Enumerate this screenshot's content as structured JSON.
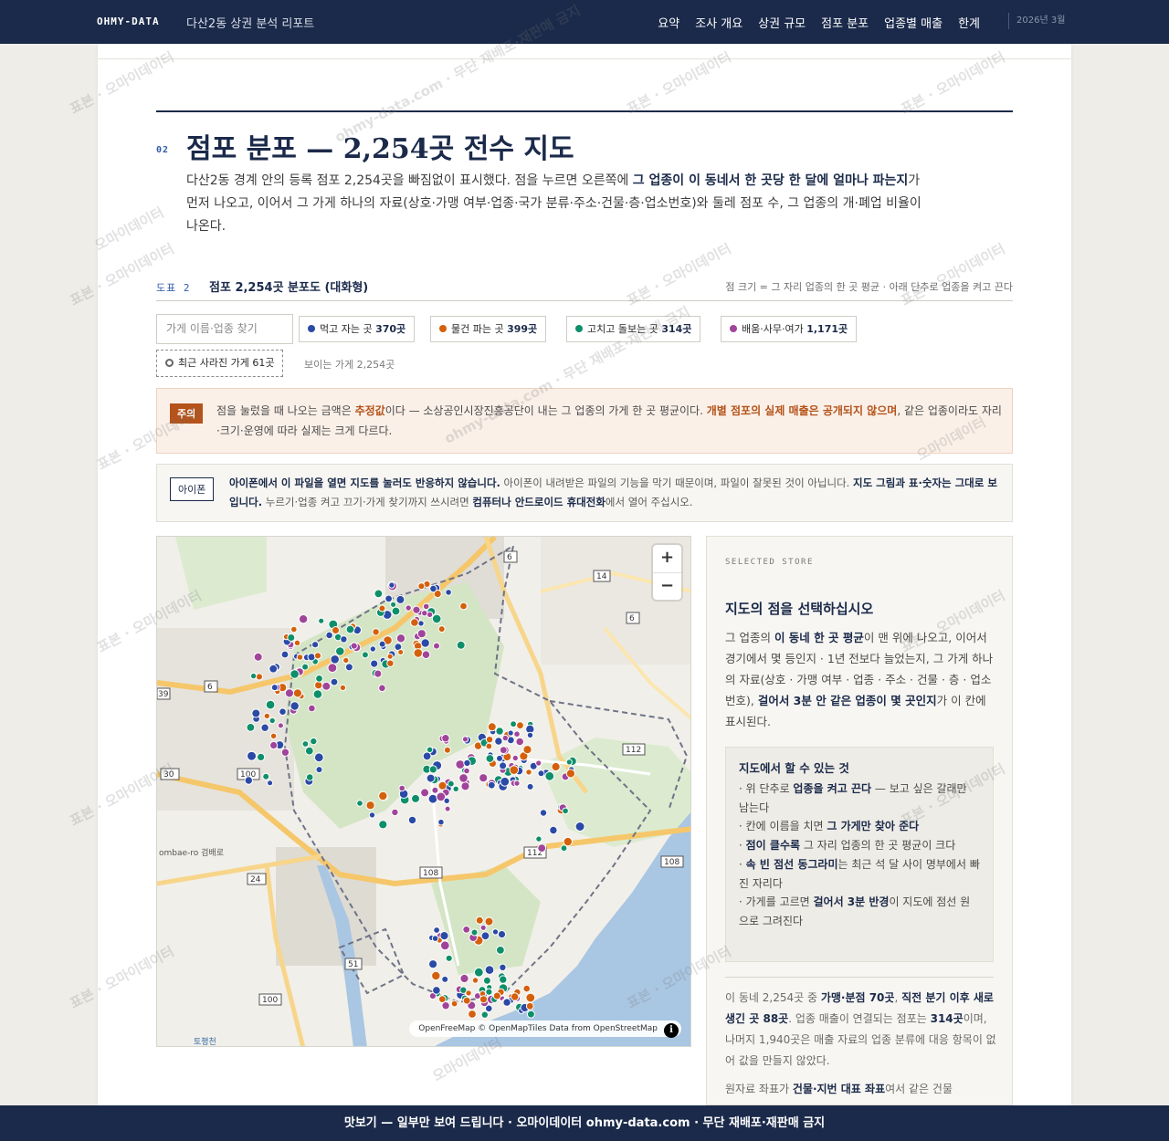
{
  "nav": {
    "brand": "OHMY-DATA",
    "report_title": "다산2동 상권 분석 리포트",
    "links": [
      "요약",
      "조사 개요",
      "상권 규모",
      "점포 분포",
      "업종별 매출",
      "한계"
    ],
    "date": "2026년 3월"
  },
  "section": {
    "number": "02",
    "title": "점포 분포 — 2,254곳 전수 지도",
    "desc_1": "다산2동 경계 안의 등록 점포 2,254곳을 빠짐없이 표시했다. 점을 누르면 오른쪽에 ",
    "desc_bold": "그 업종이 이 동네서 한 곳당 한 달에 얼마나 파는지",
    "desc_2": "가 먼저 나오고, 이어서 그 가게 하나의 자료(상호·가맹 여부·업종·국가 분류·주소·건물·층·업소번호)와 둘레 점포 수, 그 업종의 개·폐업 비율이 나온다."
  },
  "figure": {
    "number": "도표 2",
    "title": "점포 2,254곳 분포도 (대화형)",
    "note": "점 크기 = 그 자리 업종의 한 곳 평균 · 아래 단추로 업종을 켜고 끈다"
  },
  "filters": {
    "search_placeholder": "가게 이름·업종 찾기",
    "chips": [
      {
        "label": "먹고 자는 곳",
        "count": "370곳",
        "color": "#2b4aa6"
      },
      {
        "label": "물건 파는 곳",
        "count": "399곳",
        "color": "#d4600c"
      },
      {
        "label": "고치고 돌보는 곳",
        "count": "314곳",
        "color": "#0e8f6a"
      },
      {
        "label": "배움·사무·여가",
        "count": "1,171곳",
        "color": "#a0449a"
      }
    ],
    "closed_label": "최근 사라진 가게 61곳",
    "visible_count": "보이는 가게 2,254곳"
  },
  "warning": {
    "badge": "주의",
    "t1": "점을 눌렀을 때 나오는 금액은 ",
    "b1": "추정값",
    "t2": "이다 — 소상공인시장진흥공단이 내는 그 업종의 가게 한 곳 평균이다. ",
    "b2": "개별 점포의 실제 매출은 공개되지 않으며",
    "t3": ", 같은 업종이라도 자리·크기·운영에 따라 실제는 크게 다르다."
  },
  "ios": {
    "badge": "아이폰",
    "b1": "아이폰에서 이 파일을 열면 지도를 눌러도 반응하지 않습니다.",
    "t1": " 아이폰이 내려받은 파일의 기능을 막기 때문이며, 파일이 잘못된 것이 아닙니다. ",
    "b2": "지도 그림과 표·숫자는 그대로 보입니다.",
    "t2": " 누르기·업종 켜고 끄기·가게 찾기까지 쓰시려면 ",
    "b3": "컴퓨터나 안드로이드 휴대전화",
    "t3": "에서 열어 주십시오."
  },
  "map": {
    "zoom_in": "+",
    "zoom_out": "−",
    "attribution": "OpenFreeMap © OpenMapTiles Data from OpenStreetMap",
    "info": "i",
    "road_labels": [
      "6",
      "14",
      "6",
      "6",
      "39",
      "112",
      "30",
      "100",
      "24",
      "108",
      "112",
      "108",
      "51",
      "100"
    ],
    "place_labels": [
      "ombae-ro 검배로",
      "토평천"
    ]
  },
  "panel": {
    "eyebrow": "SELECTED STORE",
    "title": "지도의 점을 선택하십시오",
    "d1": "그 업종의 ",
    "db1": "이 동네 한 곳 평균",
    "d2": "이 맨 위에 나오고, 이어서 경기에서 몇 등인지 · 1년 전보다 늘었는지, 그 가게 하나의 자료(상호 · 가맹 여부 · 업종 · 주소 · 건물 · 층 · 업소번호), ",
    "db2": "걸어서 3분 안 같은 업종이 몇 곳인지",
    "d3": "가 이 칸에 표시된다.",
    "howto_title": "지도에서 할 수 있는 것",
    "h1a": "· 위 단추로 ",
    "h1b": "업종을 켜고 끈다",
    "h1c": " — 보고 싶은 갈래만 남는다",
    "h2a": "· 칸에 이름을 치면 ",
    "h2b": "그 가게만 찾아 준다",
    "h3a": "· ",
    "h3b": "점이 클수록",
    "h3c": " 그 자리 업종의 한 곳 평균이 크다",
    "h4a": "· ",
    "h4b": "속 빈 점선 동그라미",
    "h4c": "는 최근 석 달 사이 명부에서 빠진 자리다",
    "h5a": "· 가게를 고르면 ",
    "h5b": "걸어서 3분 반경",
    "h5c": "이 지도에 점선 원으로 그려진다",
    "s1": "이 동네 2,254곳 중 ",
    "sb1": "가맹·분점 70곳",
    "s2": ", ",
    "sb2": "직전 분기 이후 새로 생긴 곳 88곳",
    "s3": ". 업종 매출이 연결되는 점포는 ",
    "sb3": "314곳",
    "s4": "이며, 나머지 1,940곳은 매출 자료의 업종 분류에 대응 항목이 없어 값을 만들지 않았다.",
    "s5": "원자료 좌표가 ",
    "sb5": "건물·지번 대표 좌표",
    "s6": "여서 같은 건물"
  },
  "banner": "맛보기 — 일부만 보여 드립니다 · 오마이데이터 ohmy-data.com · 무단 재배포·재판매 금지",
  "watermark": {
    "a": "표본 · 오마이데이터",
    "b": "ohmy-data.com · 무단 재배포·재판매 금지",
    "c": "오마이데이터"
  }
}
